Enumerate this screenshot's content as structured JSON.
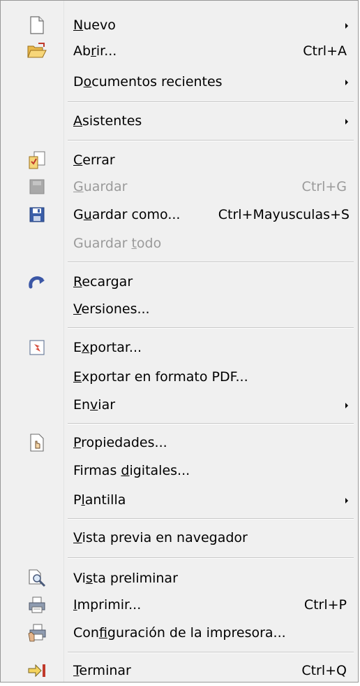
{
  "menu": {
    "items": [
      {
        "id": "nuevo",
        "pre": "",
        "ul": "N",
        "post": "uevo",
        "shortcut": "",
        "submenu": true,
        "icon": "new-document-icon",
        "disabled": false
      },
      {
        "id": "abrir",
        "pre": "Ab",
        "ul": "r",
        "post": "ir...",
        "shortcut": "Ctrl+A",
        "submenu": false,
        "icon": "open-folder-icon",
        "disabled": false
      },
      {
        "id": "documentos-recientes",
        "pre": "D",
        "ul": "o",
        "post": "cumentos recientes",
        "shortcut": "",
        "submenu": true,
        "icon": "",
        "disabled": false
      },
      {
        "id": "asistentes",
        "pre": "",
        "ul": "A",
        "post": "sistentes",
        "shortcut": "",
        "submenu": true,
        "icon": "",
        "disabled": false
      },
      {
        "id": "cerrar",
        "pre": "",
        "ul": "C",
        "post": "errar",
        "shortcut": "",
        "submenu": false,
        "icon": "close-document-icon",
        "disabled": false
      },
      {
        "id": "guardar",
        "pre": "",
        "ul": "G",
        "post": "uardar",
        "shortcut": "Ctrl+G",
        "submenu": false,
        "icon": "save-disabled-icon",
        "disabled": true
      },
      {
        "id": "guardar-como",
        "pre": "G",
        "ul": "u",
        "post": "ardar como...",
        "shortcut": "Ctrl+Mayusculas+S",
        "submenu": false,
        "icon": "save-as-icon",
        "disabled": false
      },
      {
        "id": "guardar-todo",
        "pre": "Guardar ",
        "ul": "t",
        "post": "odo",
        "shortcut": "",
        "submenu": false,
        "icon": "",
        "disabled": true
      },
      {
        "id": "recargar",
        "pre": "",
        "ul": "R",
        "post": "ecargar",
        "shortcut": "",
        "submenu": false,
        "icon": "reload-icon",
        "disabled": false
      },
      {
        "id": "versiones",
        "pre": "",
        "ul": "V",
        "post": "ersiones...",
        "shortcut": "",
        "submenu": false,
        "icon": "",
        "disabled": false
      },
      {
        "id": "exportar",
        "pre": "E",
        "ul": "x",
        "post": "portar...",
        "shortcut": "",
        "submenu": false,
        "icon": "export-icon",
        "disabled": false
      },
      {
        "id": "exportar-pdf",
        "pre": "",
        "ul": "E",
        "post": "xportar en formato PDF...",
        "shortcut": "",
        "submenu": false,
        "icon": "",
        "disabled": false
      },
      {
        "id": "enviar",
        "pre": "En",
        "ul": "v",
        "post": "iar",
        "shortcut": "",
        "submenu": true,
        "icon": "",
        "disabled": false
      },
      {
        "id": "propiedades",
        "pre": "",
        "ul": "P",
        "post": "ropiedades...",
        "shortcut": "",
        "submenu": false,
        "icon": "properties-icon",
        "disabled": false
      },
      {
        "id": "firmas-digitales",
        "pre": "Firmas ",
        "ul": "d",
        "post": "igitales...",
        "shortcut": "",
        "submenu": false,
        "icon": "",
        "disabled": false
      },
      {
        "id": "plantilla",
        "pre": "P",
        "ul": "l",
        "post": "antilla",
        "shortcut": "",
        "submenu": true,
        "icon": "",
        "disabled": false
      },
      {
        "id": "vista-previa-navegador",
        "pre": "",
        "ul": "V",
        "post": "ista previa en navegador",
        "shortcut": "",
        "submenu": false,
        "icon": "",
        "disabled": false
      },
      {
        "id": "vista-preliminar",
        "pre": "Vi",
        "ul": "s",
        "post": "ta preliminar",
        "shortcut": "",
        "submenu": false,
        "icon": "print-preview-icon",
        "disabled": false
      },
      {
        "id": "imprimir",
        "pre": "",
        "ul": "I",
        "post": "mprimir...",
        "shortcut": "Ctrl+P",
        "submenu": false,
        "icon": "printer-icon",
        "disabled": false
      },
      {
        "id": "configuracion-impresora",
        "pre": "Con",
        "ul": "f",
        "post": "iguración de la impresora...",
        "shortcut": "",
        "submenu": false,
        "icon": "printer-settings-icon",
        "disabled": false
      },
      {
        "id": "terminar",
        "pre": "",
        "ul": "T",
        "post": "erminar",
        "shortcut": "Ctrl+Q",
        "submenu": false,
        "icon": "exit-icon",
        "disabled": false
      }
    ]
  }
}
